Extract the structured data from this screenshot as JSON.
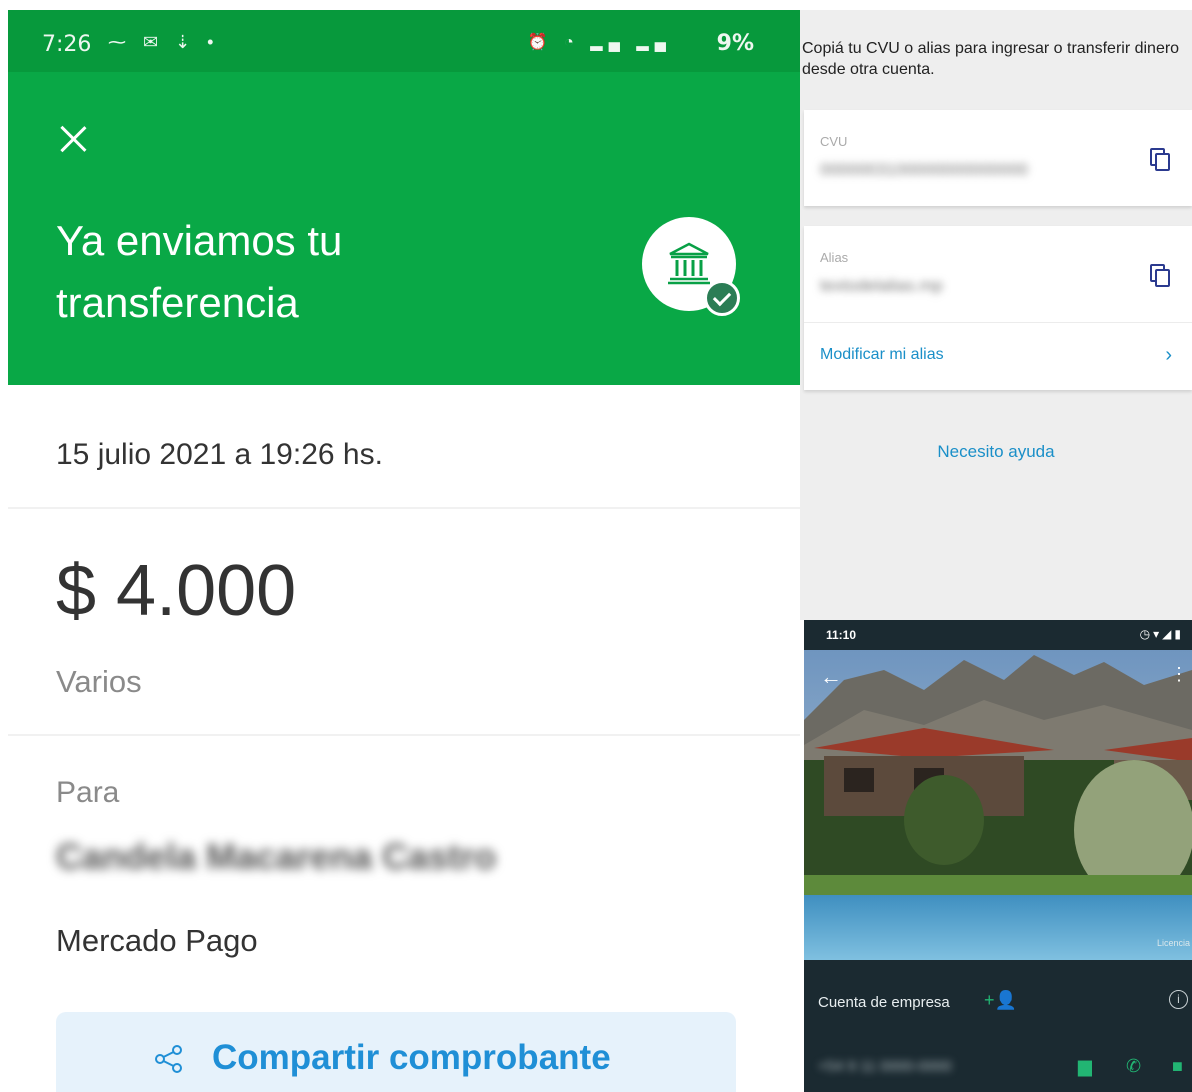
{
  "receipt": {
    "status_time": "7:26",
    "status_battery": "9%",
    "title": "Ya enviamos tu transferencia",
    "date": "15 julio 2021 a 19:26 hs.",
    "amount": "$ 4.000",
    "concept": "Varios",
    "to_label": "Para",
    "recipient_name": "Candela Macarena Castro",
    "bank": "Mercado Pago",
    "share_label": "Compartir comprobante",
    "colors": {
      "header": "#09a846",
      "statusbar": "#07993c",
      "link": "#1f8fd6"
    }
  },
  "account": {
    "intro": "Copiá tu CVU o alias para ingresar o transferir dinero desde otra cuenta.",
    "cvu_label": "CVU",
    "cvu_value": "0000003100000000000000",
    "alias_label": "Alias",
    "alias_value": "textodelalias.mp",
    "modify_alias": "Modificar mi alias",
    "help": "Necesito ayuda"
  },
  "business": {
    "status_time": "11:10",
    "watermark": "Licencia",
    "account_type": "Cuenta de empresa",
    "phone": "+54 9 11 0000-0000",
    "icons": [
      "back-arrow-icon",
      "more-icon",
      "add-person-icon",
      "info-icon",
      "message-icon",
      "call-icon",
      "video-icon"
    ]
  }
}
